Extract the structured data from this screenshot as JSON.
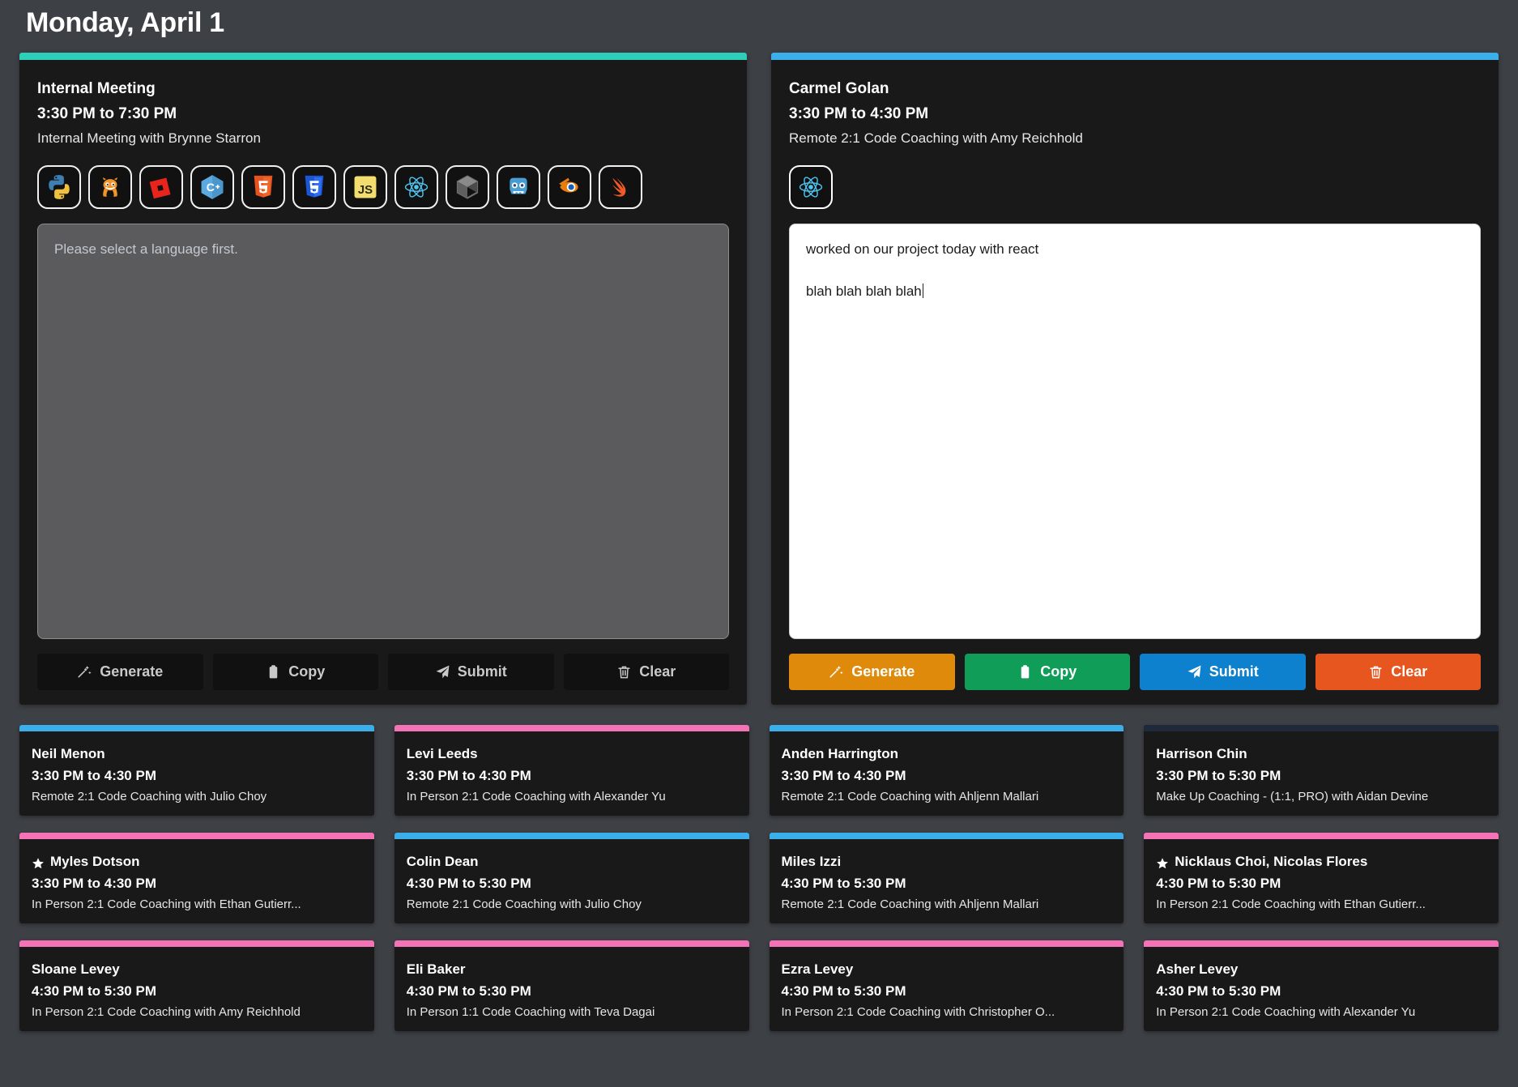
{
  "header": {
    "title": "Monday, April 1"
  },
  "colors": {
    "accent_teal": "#2ecfba",
    "accent_blue": "#3bafea",
    "accent_pink": "#f472b6",
    "accent_navy": "#1e2a3c",
    "btn_generate": "#e08a0b",
    "btn_copy": "#0f9d58",
    "btn_submit": "#0d81cd",
    "btn_clear": "#e8561f",
    "btn_disabled": "#111111",
    "page_bg": "#3d4045",
    "card_bg": "#191919"
  },
  "featured": [
    {
      "accent": "#2ecfba",
      "name": "Internal Meeting",
      "time": "3:30 PM to 7:30 PM",
      "description": "Internal Meeting with Brynne Starron",
      "languages": [
        {
          "icon": "python-icon",
          "label": "Python",
          "selected": false
        },
        {
          "icon": "scratch-icon",
          "label": "Scratch",
          "selected": false
        },
        {
          "icon": "roblox-icon",
          "label": "Roblox",
          "selected": false
        },
        {
          "icon": "cplusplus-icon",
          "label": "C++",
          "selected": false
        },
        {
          "icon": "html5-icon",
          "label": "HTML5",
          "selected": false
        },
        {
          "icon": "css3-icon",
          "label": "CSS3",
          "selected": false
        },
        {
          "icon": "javascript-icon",
          "label": "JavaScript",
          "selected": false
        },
        {
          "icon": "react-icon",
          "label": "React",
          "selected": false
        },
        {
          "icon": "unity-icon",
          "label": "Unity",
          "selected": false
        },
        {
          "icon": "godot-icon",
          "label": "Godot",
          "selected": false
        },
        {
          "icon": "blender-icon",
          "label": "Blender",
          "selected": false
        },
        {
          "icon": "swift-icon",
          "label": "Swift",
          "selected": false
        }
      ],
      "note": {
        "value": "",
        "placeholder": "Please select a language first.",
        "enabled": false,
        "caret": false
      },
      "buttons": [
        {
          "label": "Generate",
          "icon": "wand-icon",
          "enabled": false
        },
        {
          "label": "Copy",
          "icon": "clipboard-icon",
          "enabled": false
        },
        {
          "label": "Submit",
          "icon": "paper-plane-icon",
          "enabled": false
        },
        {
          "label": "Clear",
          "icon": "trash-icon",
          "enabled": false
        }
      ]
    },
    {
      "accent": "#3bafea",
      "name": "Carmel Golan",
      "time": "3:30 PM to 4:30 PM",
      "description": "Remote 2:1 Code Coaching with Amy Reichhold",
      "languages": [
        {
          "icon": "react-icon",
          "label": "React",
          "selected": true
        }
      ],
      "note": {
        "value": "worked on our project today with react\n\nblah blah blah blah",
        "placeholder": "",
        "enabled": true,
        "caret": true
      },
      "buttons": [
        {
          "label": "Generate",
          "icon": "wand-icon",
          "enabled": true,
          "color": "#e08a0b"
        },
        {
          "label": "Copy",
          "icon": "clipboard-icon",
          "enabled": true,
          "color": "#0f9d58"
        },
        {
          "label": "Submit",
          "icon": "paper-plane-icon",
          "enabled": true,
          "color": "#0d81cd"
        },
        {
          "label": "Clear",
          "icon": "trash-icon",
          "enabled": true,
          "color": "#e8561f"
        }
      ]
    }
  ],
  "sessions": [
    {
      "accent": "#3bafea",
      "starred": false,
      "name": "Neil Menon",
      "time": "3:30 PM to 4:30 PM",
      "description": "Remote 2:1 Code Coaching with Julio Choy"
    },
    {
      "accent": "#f472b6",
      "starred": false,
      "name": "Levi Leeds",
      "time": "3:30 PM to 4:30 PM",
      "description": "In Person 2:1 Code Coaching with Alexander Yu"
    },
    {
      "accent": "#3bafea",
      "starred": false,
      "name": "Anden Harrington",
      "time": "3:30 PM to 4:30 PM",
      "description": "Remote 2:1 Code Coaching with Ahljenn Mallari"
    },
    {
      "accent": "#1e2a3c",
      "starred": false,
      "name": "Harrison Chin",
      "time": "3:30 PM to 5:30 PM",
      "description": "Make Up Coaching - (1:1, PRO) with Aidan Devine"
    },
    {
      "accent": "#f472b6",
      "starred": true,
      "name": "Myles Dotson",
      "time": "3:30 PM to 4:30 PM",
      "description": "In Person 2:1 Code Coaching with Ethan Gutierr..."
    },
    {
      "accent": "#3bafea",
      "starred": false,
      "name": "Colin Dean",
      "time": "4:30 PM to 5:30 PM",
      "description": "Remote 2:1 Code Coaching with Julio Choy"
    },
    {
      "accent": "#3bafea",
      "starred": false,
      "name": "Miles Izzi",
      "time": "4:30 PM to 5:30 PM",
      "description": "Remote 2:1 Code Coaching with Ahljenn Mallari"
    },
    {
      "accent": "#f472b6",
      "starred": true,
      "name": "Nicklaus Choi, Nicolas Flores",
      "time": "4:30 PM to 5:30 PM",
      "description": "In Person 2:1 Code Coaching with Ethan Gutierr..."
    },
    {
      "accent": "#f472b6",
      "starred": false,
      "name": "Sloane Levey",
      "time": "4:30 PM to 5:30 PM",
      "description": "In Person 2:1 Code Coaching with Amy Reichhold"
    },
    {
      "accent": "#f472b6",
      "starred": false,
      "name": "Eli Baker",
      "time": "4:30 PM to 5:30 PM",
      "description": "In Person 1:1 Code Coaching with Teva Dagai"
    },
    {
      "accent": "#f472b6",
      "starred": false,
      "name": "Ezra Levey",
      "time": "4:30 PM to 5:30 PM",
      "description": "In Person 2:1 Code Coaching with Christopher O..."
    },
    {
      "accent": "#f472b6",
      "starred": false,
      "name": "Asher Levey",
      "time": "4:30 PM to 5:30 PM",
      "description": "In Person 2:1 Code Coaching with Alexander Yu"
    }
  ]
}
